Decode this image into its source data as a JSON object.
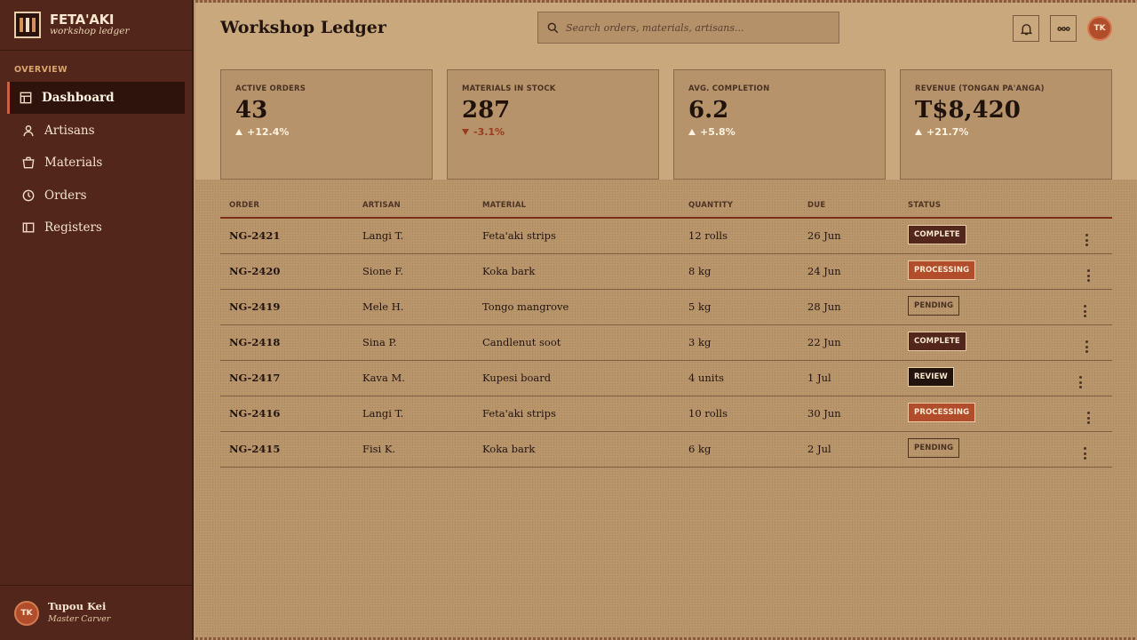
{
  "brand": {
    "name": "FETA'AKI",
    "subtitle": "workshop ledger"
  },
  "sidebar": {
    "section": "OVERVIEW",
    "items": [
      {
        "label": "Dashboard",
        "icon": "dashboard-icon",
        "active": true
      },
      {
        "label": "Artisans",
        "icon": "user-icon",
        "active": false
      },
      {
        "label": "Materials",
        "icon": "basket-icon",
        "active": false
      },
      {
        "label": "Orders",
        "icon": "clock-icon",
        "active": false
      },
      {
        "label": "Registers",
        "icon": "register-icon",
        "active": false
      }
    ],
    "user": {
      "initials": "TK",
      "name": "Tupou Kei",
      "role": "Master Carver"
    }
  },
  "header": {
    "title": "Workshop Ledger",
    "search_placeholder": "Search orders, materials, artisans...",
    "avatar_initials": "TK"
  },
  "stats": [
    {
      "label": "ACTIVE ORDERS",
      "value": "43",
      "delta": "+12.4%",
      "trend": "up"
    },
    {
      "label": "MATERIALS IN STOCK",
      "value": "287",
      "delta": "-3.1%",
      "trend": "down"
    },
    {
      "label": "AVG. COMPLETION",
      "value": "6.2",
      "delta": "+5.8%",
      "trend": "up"
    },
    {
      "label": "REVENUE (TONGAN PA'ANGA)",
      "value": "T$8,420",
      "delta": "+21.7%",
      "trend": "up"
    }
  ],
  "table": {
    "columns": [
      "ORDER",
      "ARTISAN",
      "MATERIAL",
      "QUANTITY",
      "DUE",
      "STATUS"
    ],
    "rows": [
      {
        "order": "NG-2421",
        "artisan": "Langi T.",
        "material": "Feta'aki strips",
        "quantity": "12 rolls",
        "due": "26 Jun",
        "status": "COMPLETE",
        "status_kind": "complete"
      },
      {
        "order": "NG-2420",
        "artisan": "Sione F.",
        "material": "Koka bark",
        "quantity": "8 kg",
        "due": "24 Jun",
        "status": "PROCESSING",
        "status_kind": "processing"
      },
      {
        "order": "NG-2419",
        "artisan": "Mele H.",
        "material": "Tongo mangrove",
        "quantity": "5 kg",
        "due": "28 Jun",
        "status": "PENDING",
        "status_kind": "pending"
      },
      {
        "order": "NG-2418",
        "artisan": "Sina P.",
        "material": "Candlenut soot",
        "quantity": "3 kg",
        "due": "22 Jun",
        "status": "COMPLETE",
        "status_kind": "complete"
      },
      {
        "order": "NG-2417",
        "artisan": "Kava M.",
        "material": "Kupesi board",
        "quantity": "4 units",
        "due": "1 Jul",
        "status": "REVIEW",
        "status_kind": "review"
      },
      {
        "order": "NG-2416",
        "artisan": "Langi T.",
        "material": "Feta'aki strips",
        "quantity": "10 rolls",
        "due": "30 Jun",
        "status": "PROCESSING",
        "status_kind": "processing"
      },
      {
        "order": "NG-2415",
        "artisan": "Fisi K.",
        "material": "Koka bark",
        "quantity": "6 kg",
        "due": "2 Jul",
        "status": "PENDING",
        "status_kind": "pending"
      }
    ]
  },
  "colors": {
    "sidebar_bg": "#52261a",
    "accent": "#b14d2b",
    "page_bg": "#b9956c",
    "header_bg": "#c9a87e"
  }
}
